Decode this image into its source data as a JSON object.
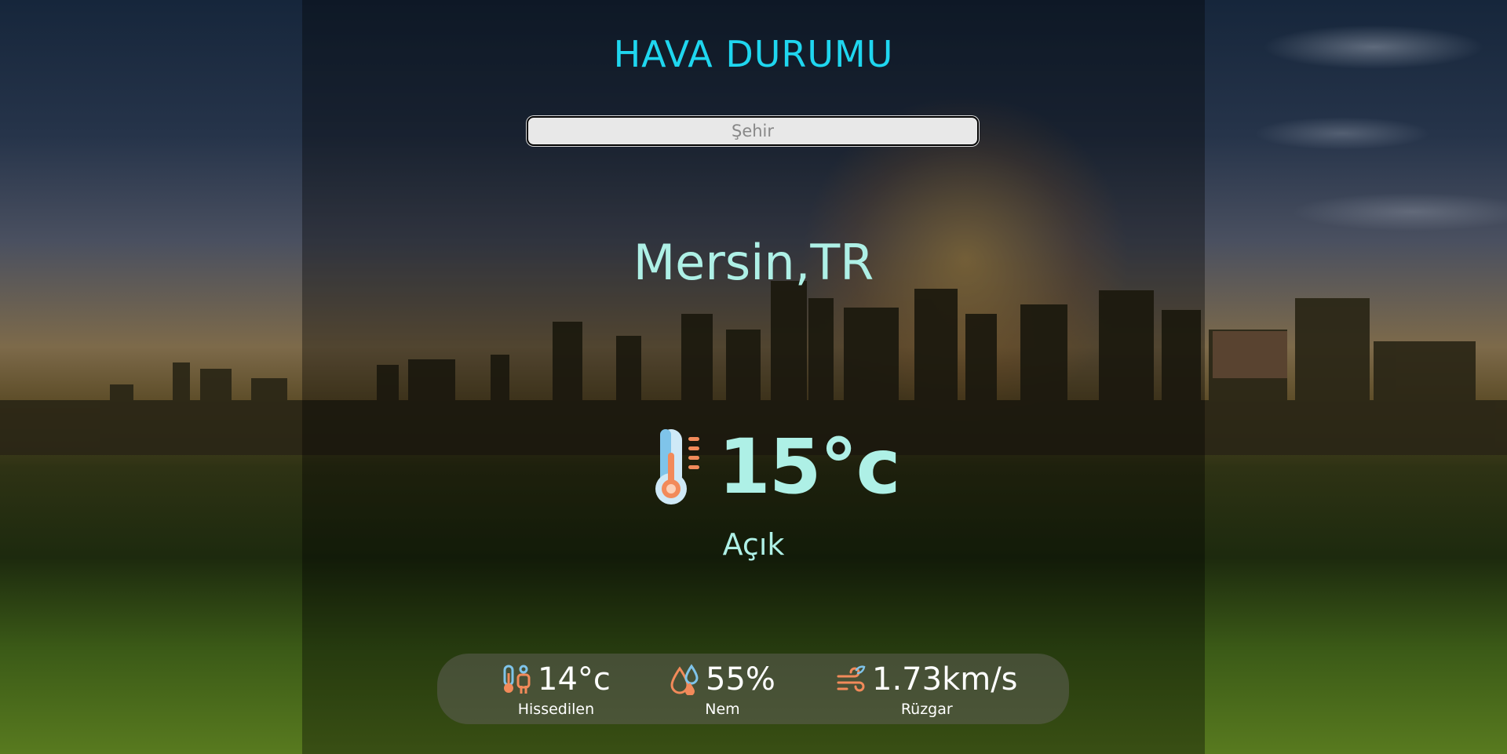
{
  "app": {
    "title": "HAVA DURUMU",
    "accent_color": "#1fd6ef",
    "text_color": "#aef0e6"
  },
  "search": {
    "placeholder": "Şehir",
    "value": ""
  },
  "location": {
    "city": "Mersin,TR"
  },
  "current": {
    "temperature": "15°c",
    "condition": "Açık",
    "icon": "thermometer-icon"
  },
  "stats": [
    {
      "value": "14°c",
      "label": "Hissedilen",
      "icon": "feels-like-icon"
    },
    {
      "value": "55%",
      "label": "Nem",
      "icon": "humidity-icon"
    },
    {
      "value": "1.73km/s",
      "label": "Rüzgar",
      "icon": "wind-icon"
    }
  ]
}
